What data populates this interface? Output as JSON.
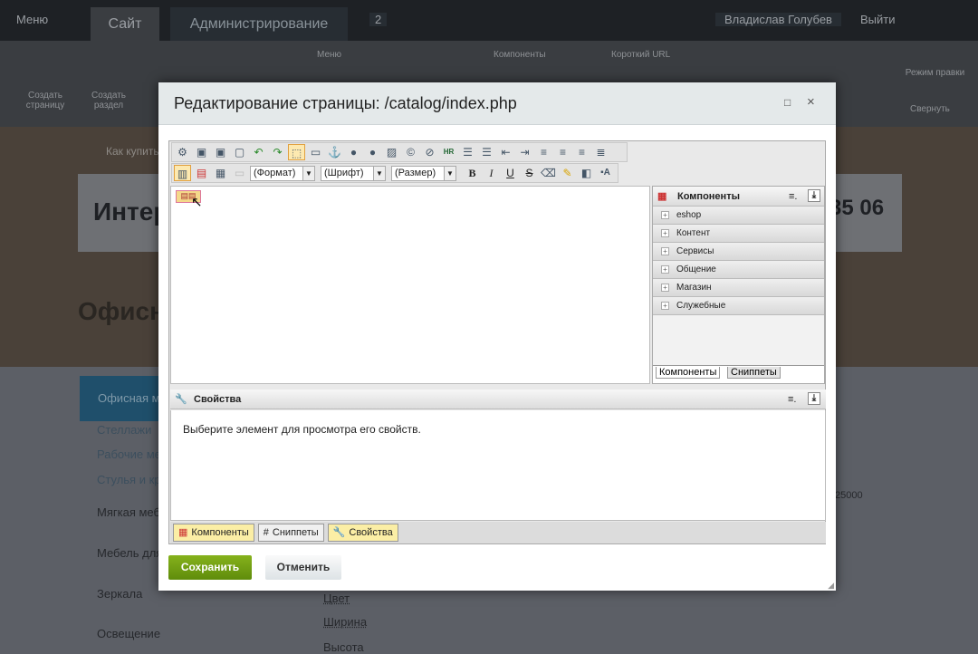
{
  "topbar": {
    "menu": "Меню",
    "tab_site": "Сайт",
    "tab_admin": "Администрирование",
    "notifications": "2",
    "user": "Владислав Голубев",
    "logout": "Выйти"
  },
  "ribbon": {
    "create_page": "Создать страницу",
    "create_section": "Создать раздел",
    "menu": "Меню",
    "components": "Компоненты",
    "short_url": "Короткий URL",
    "edit_mode": "Режим правки",
    "hide": "Свернуть"
  },
  "site": {
    "breadcrumb": "Как купить",
    "header_title": "Интернет-магазин",
    "phone": "35 06",
    "section_title": "Офисная мебель",
    "menu": [
      "Офисная мебель",
      "Стеллажи",
      "Рабочие места",
      "Стулья и кресла",
      "Мягкая мебель",
      "Мебель для дома",
      "Зеркала",
      "Освещение"
    ],
    "filters": [
      "Цвет",
      "Ширина",
      "Высота"
    ],
    "price": "25000"
  },
  "dialog": {
    "title": "Редактирование страницы: /catalog/index.php",
    "toolbar": {
      "row1_icons": [
        "settings-icon",
        "paste-word-icon",
        "paste-text-icon",
        "paste-icon",
        "undo-icon",
        "redo-icon",
        "select-all-icon",
        "table-icon",
        "anchor-icon",
        "link-icon",
        "unlink-icon",
        "image-icon",
        "copyright-icon",
        "flash-icon",
        "hr-icon",
        "ordered-list-icon",
        "bullet-list-icon",
        "outdent-icon",
        "indent-icon",
        "align-left-icon",
        "align-center-icon",
        "align-right-icon",
        "justify-icon"
      ],
      "format": "(Формат)",
      "font": "(Шрифт)",
      "size": "(Размер)",
      "bold": "B",
      "italic": "I",
      "underline": "U",
      "strike": "S"
    },
    "components_panel": {
      "title": "Компоненты",
      "items": [
        "eshop",
        "Контент",
        "Сервисы",
        "Общение",
        "Магазин",
        "Служебные"
      ],
      "tab_components": "Компоненты",
      "tab_snippets": "Сниппеты"
    },
    "properties": {
      "title": "Свойства",
      "hint": "Выберите элемент для просмотра его свойств."
    },
    "bottom_tabs": [
      "Компоненты",
      "Сниппеты",
      "Свойства"
    ],
    "save": "Сохранить",
    "cancel": "Отменить"
  },
  "colors": {
    "save_green": "#6e9a0e",
    "title_bar": "#e4e9ea",
    "active_tab": "#fbeea5"
  }
}
